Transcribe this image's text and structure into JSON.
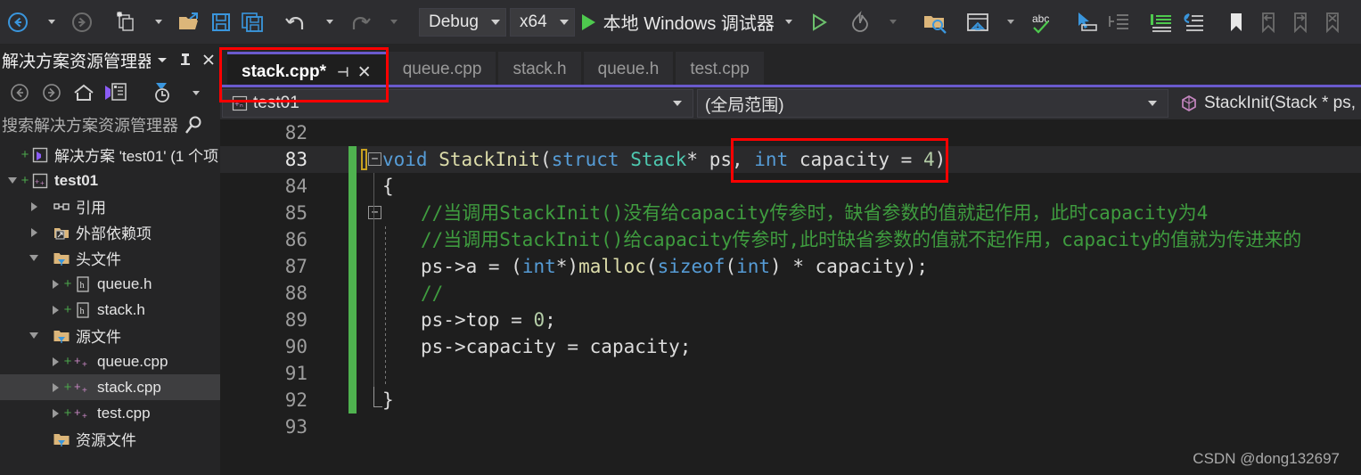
{
  "toolbar": {
    "nav_back": "navigate-backward",
    "nav_forward": "navigate-forward",
    "new_item": "new-item",
    "open_file": "open-file",
    "save": "save",
    "save_all": "save-all",
    "undo": "undo",
    "redo": "redo",
    "config_label": "Debug",
    "platform_label": "x64",
    "run_label": "本地 Windows 调试器",
    "hot_reload": "hot-reload",
    "find_in_files": "find-in-files",
    "preview_window": "preview-window",
    "spell_check": "abc-spell-check",
    "select_tool": "pointer-select",
    "outdent_block": "outdent-block",
    "comment_block": "comment-selection",
    "uncomment_block": "uncomment-selection",
    "toggle_bookmark": "toggle-bookmark",
    "prev_bookmark": "previous-bookmark",
    "next_bookmark": "next-bookmark",
    "clear_bookmarks": "clear-bookmarks",
    "overflow": "toolbar-overflow"
  },
  "solution_explorer": {
    "title": "解决方案资源管理器",
    "search_placeholder": "搜索解决方案资源管理器",
    "tools": {
      "back": "back",
      "forward": "forward",
      "home": "home",
      "view_code": "view-designer",
      "pending_changes": "pending-changes-filter",
      "overflow": "chevron-overflow"
    },
    "tree": [
      {
        "label": "解决方案 'test01' (1 个项",
        "depth": 0,
        "expander": "none",
        "icon": "solution-icon",
        "plus": true,
        "bold": false,
        "selected": false
      },
      {
        "label": "test01",
        "depth": 0,
        "expander": "down",
        "icon": "cpp-project-icon",
        "plus": true,
        "bold": true,
        "selected": false
      },
      {
        "label": "引用",
        "depth": 1,
        "expander": "right",
        "icon": "references-icon",
        "plus": false,
        "bold": false,
        "selected": false
      },
      {
        "label": "外部依赖项",
        "depth": 1,
        "expander": "right",
        "icon": "external-deps-icon",
        "plus": false,
        "bold": false,
        "selected": false
      },
      {
        "label": "头文件",
        "depth": 1,
        "expander": "down",
        "icon": "filter-folder-icon",
        "plus": false,
        "bold": false,
        "selected": false
      },
      {
        "label": "queue.h",
        "depth": 2,
        "expander": "right",
        "icon": "header-file-icon",
        "plus": true,
        "bold": false,
        "selected": false
      },
      {
        "label": "stack.h",
        "depth": 2,
        "expander": "right",
        "icon": "header-file-icon",
        "plus": true,
        "bold": false,
        "selected": false
      },
      {
        "label": "源文件",
        "depth": 1,
        "expander": "down",
        "icon": "filter-folder-icon",
        "plus": false,
        "bold": false,
        "selected": false
      },
      {
        "label": "queue.cpp",
        "depth": 2,
        "expander": "right",
        "icon": "cpp-file-icon",
        "plus": true,
        "bold": false,
        "selected": false
      },
      {
        "label": "stack.cpp",
        "depth": 2,
        "expander": "right",
        "icon": "cpp-file-icon",
        "plus": true,
        "bold": false,
        "selected": true
      },
      {
        "label": "test.cpp",
        "depth": 2,
        "expander": "right",
        "icon": "cpp-file-icon",
        "plus": true,
        "bold": false,
        "selected": false
      },
      {
        "label": "资源文件",
        "depth": 1,
        "expander": "none",
        "icon": "filter-folder-icon",
        "plus": false,
        "bold": false,
        "selected": false
      }
    ]
  },
  "tabs": [
    {
      "label": "stack.cpp*",
      "active": true,
      "pin": "⊣",
      "close": "✕"
    },
    {
      "label": "queue.cpp",
      "active": false,
      "pin": "",
      "close": ""
    },
    {
      "label": "stack.h",
      "active": false,
      "pin": "",
      "close": ""
    },
    {
      "label": "queue.h",
      "active": false,
      "pin": "",
      "close": ""
    },
    {
      "label": "test.cpp",
      "active": false,
      "pin": "",
      "close": ""
    }
  ],
  "navbar": {
    "project": "test01",
    "scope": "(全局范围)",
    "member": "StackInit(Stack * ps,"
  },
  "editor": {
    "lines": [
      {
        "num": "82",
        "current": false,
        "change": false,
        "segments": []
      },
      {
        "num": "83",
        "current": true,
        "change": true,
        "fold": "−",
        "cursor": true,
        "indent": false,
        "segments": [
          {
            "t": "void",
            "c": "k"
          },
          {
            "t": " ",
            "c": "id"
          },
          {
            "t": "StackInit",
            "c": "fn"
          },
          {
            "t": "(",
            "c": "pn"
          },
          {
            "t": "struct",
            "c": "k"
          },
          {
            "t": " ",
            "c": "id"
          },
          {
            "t": "Stack",
            "c": "ty"
          },
          {
            "t": "* ps, ",
            "c": "id"
          },
          {
            "t": "int",
            "c": "k"
          },
          {
            "t": " capacity = ",
            "c": "id"
          },
          {
            "t": "4",
            "c": "num"
          },
          {
            "t": ")",
            "c": "pn"
          }
        ]
      },
      {
        "num": "84",
        "current": false,
        "change": true,
        "guide": true,
        "indent": false,
        "segments": [
          {
            "t": "{",
            "c": "pn"
          }
        ]
      },
      {
        "num": "85",
        "current": false,
        "change": true,
        "fold": "−",
        "guide": true,
        "indent": true,
        "segments": [
          {
            "t": "//当调用StackInit()没有给capacity传参时，缺省参数的值就起作用，此时capacity为4",
            "c": "cm"
          }
        ]
      },
      {
        "num": "86",
        "current": false,
        "change": true,
        "guide": true,
        "guide2": true,
        "indent": true,
        "segments": [
          {
            "t": "//当调用StackInit()给capacity传参时,此时缺省参数的值就不起作用，capacity的值就为传进来的",
            "c": "cm"
          }
        ]
      },
      {
        "num": "87",
        "current": false,
        "change": true,
        "guide": true,
        "guide2": true,
        "indent": true,
        "segments": [
          {
            "t": "ps",
            "c": "id"
          },
          {
            "t": "->",
            "c": "pn"
          },
          {
            "t": "a = ",
            "c": "id"
          },
          {
            "t": "(",
            "c": "pn"
          },
          {
            "t": "int",
            "c": "k"
          },
          {
            "t": "*)",
            "c": "pn"
          },
          {
            "t": "malloc",
            "c": "fn"
          },
          {
            "t": "(",
            "c": "pn"
          },
          {
            "t": "sizeof",
            "c": "k"
          },
          {
            "t": "(",
            "c": "pn"
          },
          {
            "t": "int",
            "c": "k"
          },
          {
            "t": ") * capacity);",
            "c": "id"
          }
        ]
      },
      {
        "num": "88",
        "current": false,
        "change": true,
        "guide": true,
        "guide2": true,
        "indent": true,
        "segments": [
          {
            "t": "//",
            "c": "cm"
          }
        ]
      },
      {
        "num": "89",
        "current": false,
        "change": true,
        "guide": true,
        "guide2": true,
        "indent": true,
        "segments": [
          {
            "t": "ps",
            "c": "id"
          },
          {
            "t": "->",
            "c": "pn"
          },
          {
            "t": "top = ",
            "c": "id"
          },
          {
            "t": "0",
            "c": "num"
          },
          {
            "t": ";",
            "c": "pn"
          }
        ]
      },
      {
        "num": "90",
        "current": false,
        "change": true,
        "guide": true,
        "guide2": true,
        "indent": true,
        "segments": [
          {
            "t": "ps",
            "c": "id"
          },
          {
            "t": "->",
            "c": "pn"
          },
          {
            "t": "capacity = capacity;",
            "c": "id"
          }
        ]
      },
      {
        "num": "91",
        "current": false,
        "change": true,
        "guide": true,
        "guide2": true,
        "indent": true,
        "segments": []
      },
      {
        "num": "92",
        "current": false,
        "change": true,
        "corner": true,
        "indent": false,
        "segments": [
          {
            "t": "}",
            "c": "pn"
          }
        ]
      },
      {
        "num": "93",
        "current": false,
        "change": false,
        "segments": []
      }
    ]
  },
  "watermark": "CSDN @dong132697",
  "colors": {
    "accent_purple": "#6a5acd",
    "annotation_red": "#ff0000",
    "change_bar_green": "#4fb24f",
    "run_green": "#4ec94e",
    "editor_bg": "#1e1e1e",
    "chrome_bg": "#2d2d30",
    "panel_bg": "#252526"
  }
}
